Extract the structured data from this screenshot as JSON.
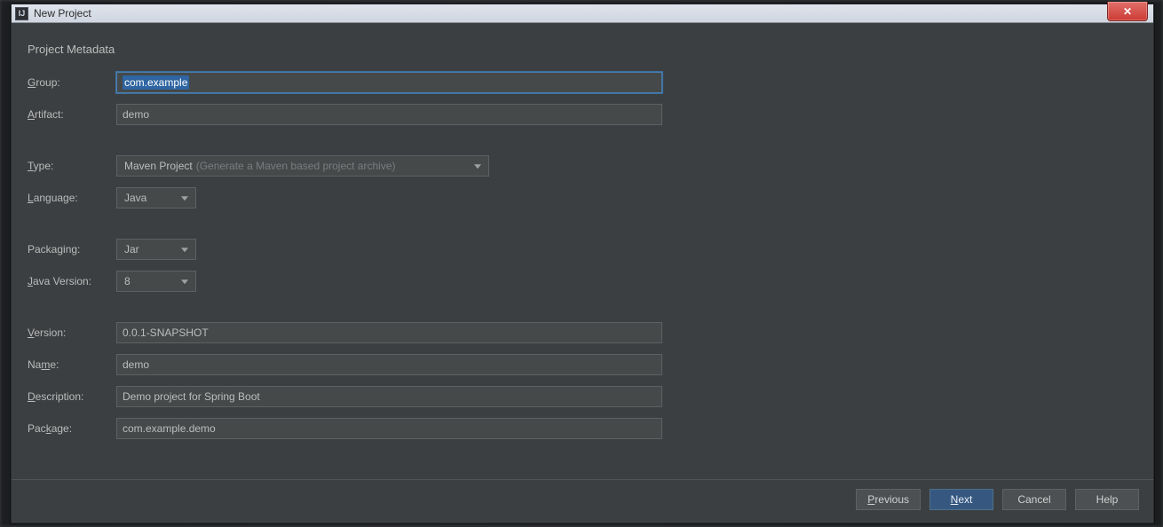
{
  "titlebar": {
    "app_icon_letter": "IJ",
    "title": "New Project"
  },
  "close_x": "✕",
  "section": {
    "title": "Project Metadata"
  },
  "labels": {
    "group_pre": "",
    "group_u": "G",
    "group_post": "roup:",
    "artifact_u": "A",
    "artifact_post": "rtifact:",
    "type_u": "T",
    "type_post": "ype:",
    "language_u": "L",
    "language_post": "anguage:",
    "packaging_text": "Packaging:",
    "javav_u": "J",
    "javav_post": "ava Version:",
    "version_u": "V",
    "version_post": "ersion:",
    "name_pre": "Na",
    "name_u": "m",
    "name_post": "e:",
    "desc_u": "D",
    "desc_post": "escription:",
    "package_pre": "Pac",
    "package_u": "k",
    "package_post": "age:"
  },
  "fields": {
    "group": "com.example",
    "artifact": "demo",
    "type_value": "Maven Project",
    "type_hint": "(Generate a Maven based project archive)",
    "language": "Java",
    "packaging": "Jar",
    "java_version": "8",
    "version": "0.0.1-SNAPSHOT",
    "name": "demo",
    "description": "Demo project for Spring Boot",
    "package": "com.example.demo"
  },
  "buttons": {
    "previous_u": "P",
    "previous_rest": "revious",
    "next_u": "N",
    "next_rest": "ext",
    "cancel": "Cancel",
    "help": "Help"
  }
}
